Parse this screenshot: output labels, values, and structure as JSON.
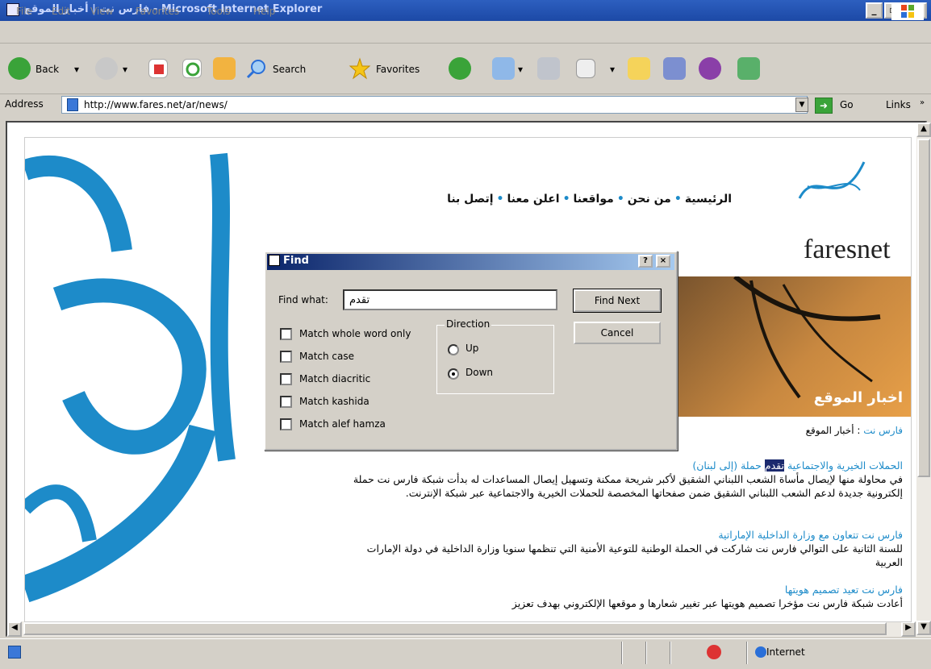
{
  "window": {
    "title": "فارس نت | أخبار الموقع - Microsoft Internet Explorer",
    "min": "_",
    "max": "▫",
    "close": "×"
  },
  "menu": [
    "File",
    "Edit",
    "View",
    "Favorites",
    "Tools",
    "Help"
  ],
  "toolbar": {
    "back": "Back",
    "search": "Search",
    "favorites": "Favorites"
  },
  "address": {
    "label": "Address",
    "url": "http://www.fares.net/ar/news/",
    "go": "Go",
    "links": "Links"
  },
  "page": {
    "logo": "faresnet",
    "nav": [
      "الرئيسية",
      "من نحن",
      "مواقعنا",
      "اعلن معنا",
      "إتصل بنا"
    ],
    "banner_title": "اخبار الموقع",
    "breadcrumb_site": "فارس نت",
    "breadcrumb_sep": " : ",
    "breadcrumb_page": "أخبار الموقع",
    "news": [
      {
        "heading_pre": "الحملات الخيرية والاجتماعية ",
        "heading_hl": "تقدم",
        "heading_post": " حملة (إلى لبنان)",
        "body": "في محاولة منها لإيصال مأساة الشعب اللبناني الشقيق لأكبر شريحة ممكنة وتسهيل إيصال المساعدات له بدأت شبكة فارس نت حملة إلكترونية جديدة لدعم الشعب اللبناني الشقيق ضمن صفحاتها المخصصة للحملات الخيرية والاجتماعية عبر شبكة الإنترنت."
      },
      {
        "heading": "فارس نت تتعاون مع وزارة الداخلية الإماراتية",
        "body": "للسنة الثانية على التوالي فارس نت شاركت في الحملة الوطنية للتوعية الأمنية التي تنظمها سنويا وزارة الداخلية في دولة الإمارات العربية"
      },
      {
        "heading": "فارس نت تعيد تصميم هويتها",
        "body": "أعادت شبكة فارس نت مؤخرا تصميم هويتها عبر تغيير شعارها و موقعها الإلكتروني بهدف تعزيز"
      }
    ]
  },
  "find_dialog": {
    "title": "Find",
    "help": "?",
    "close": "×",
    "find_what_label": "Find what:",
    "find_what_value": "تقدم",
    "find_next": "Find Next",
    "cancel": "Cancel",
    "options": [
      "Match whole word only",
      "Match case",
      "Match diacritic",
      "Match kashida",
      "Match alef hamza"
    ],
    "direction_label": "Direction",
    "direction_up": "Up",
    "direction_down": "Down",
    "direction_selected": "Down"
  },
  "status": {
    "zone": "Internet"
  }
}
